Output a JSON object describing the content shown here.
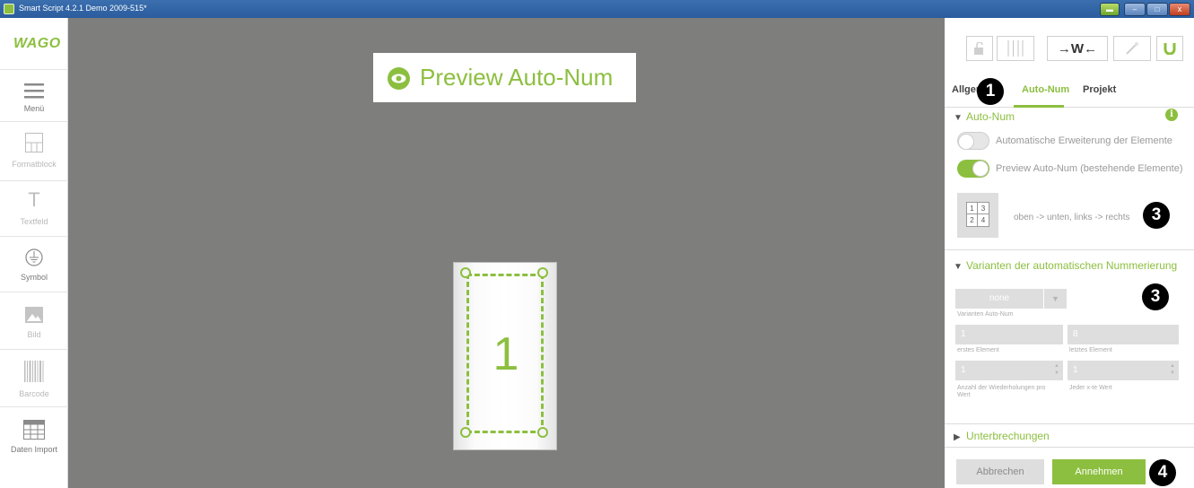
{
  "window": {
    "title": "Smart Script 4.2.1  Demo 2009-515*",
    "controls": {
      "close_glyph": "x"
    }
  },
  "sidebar": {
    "logo": "WAGO",
    "tools": [
      {
        "label": "Menü",
        "icon": "menu-icon"
      },
      {
        "label": "Formatblock",
        "icon": "formatblock-icon"
      },
      {
        "label": "Textfeld",
        "icon": "textfield-icon",
        "glyph": "T"
      },
      {
        "label": "Symbol",
        "icon": "ground-symbol-icon"
      },
      {
        "label": "Bild",
        "icon": "image-icon"
      },
      {
        "label": "Barcode",
        "icon": "barcode-icon"
      },
      {
        "label": "Daten Import",
        "icon": "table-import-icon"
      }
    ]
  },
  "canvas": {
    "banner": "Preview Auto-Num",
    "marker_number": "1"
  },
  "panel": {
    "toolbar": [
      {
        "icon": "lock-icon"
      },
      {
        "icon": "columns-icon"
      },
      {
        "icon": "width-arrows-icon",
        "glyph": "→W←"
      },
      {
        "icon": "magic-wand-icon"
      },
      {
        "icon": "magnet-icon"
      }
    ],
    "tabs": {
      "allgemein": "Allgem",
      "autonum": "Auto-Num",
      "projekt": "Projekt"
    },
    "autonum_section": {
      "title": "Auto-Num",
      "toggle_1": {
        "label": "Automatische Erweiterung der Elemente",
        "on": false
      },
      "toggle_2": {
        "label": "Preview Auto-Num (bestehende Elemente)",
        "on": true
      },
      "order_icon": [
        "1",
        "3",
        "2",
        "4"
      ],
      "order_text": "oben -> unten, links -> rechts"
    },
    "variants_section": {
      "title": "Varianten der automatischen Nummerierung",
      "variant_select": {
        "value": "none",
        "caption": "Varianten Auto-Num"
      },
      "first": {
        "value": "1",
        "caption": "erstes Element"
      },
      "last": {
        "value": "8",
        "caption": "letztes Element"
      },
      "repeat": {
        "value": "1",
        "caption": "Anzahl der Wiederholungen pro Wert"
      },
      "every": {
        "value": "1",
        "caption": "Jeder x-te Wert"
      }
    },
    "interruptions_section": {
      "title": "Unterbrechungen"
    },
    "buttons": {
      "cancel": "Abbrechen",
      "accept": "Annehmen"
    }
  },
  "callouts": {
    "c1": "1",
    "c3a": "3",
    "c3b": "3",
    "c4": "4"
  },
  "colors": {
    "accent": "#8cbf3f",
    "canvas_bg": "#7e7e7c",
    "titlebar": "#2a5c9e"
  }
}
